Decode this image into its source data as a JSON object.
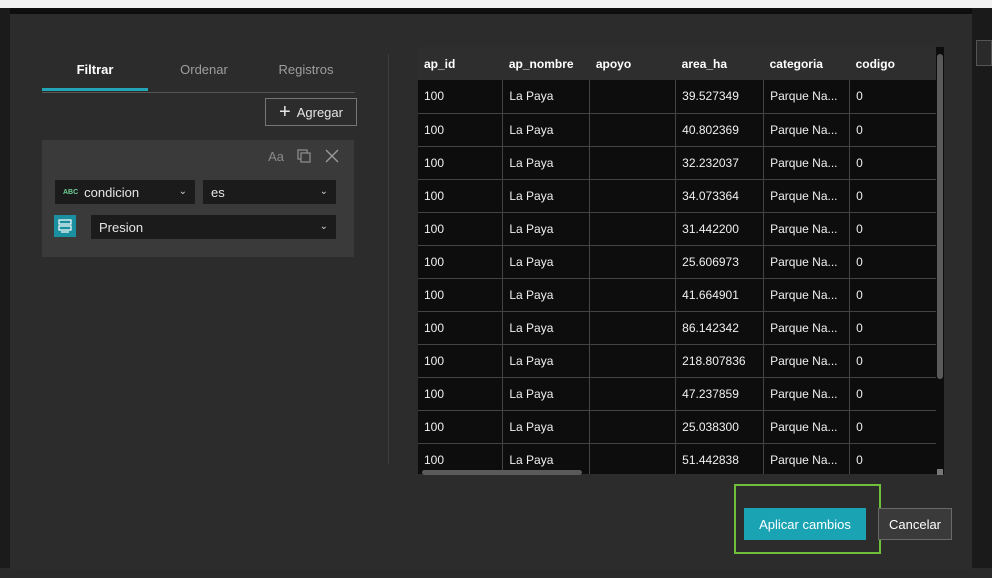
{
  "tabs": [
    {
      "label": "Filtrar"
    },
    {
      "label": "Ordenar"
    },
    {
      "label": "Registros"
    }
  ],
  "add_button": {
    "label": "Agregar"
  },
  "filter_card": {
    "tools": {
      "case_label": "Aa"
    },
    "field_select": {
      "type_label": "ABC",
      "value": "condicion"
    },
    "operator_select": {
      "value": "es"
    },
    "value_select": {
      "value": "Presion"
    }
  },
  "table": {
    "columns": [
      "ap_id",
      "ap_nombre",
      "apoyo",
      "area_ha",
      "categoria",
      "codigo"
    ],
    "rows": [
      [
        "100",
        "La Paya",
        "",
        "39.527349",
        "Parque Na...",
        "0"
      ],
      [
        "100",
        "La Paya",
        "",
        "40.802369",
        "Parque Na...",
        "0"
      ],
      [
        "100",
        "La Paya",
        "",
        "32.232037",
        "Parque Na...",
        "0"
      ],
      [
        "100",
        "La Paya",
        "",
        "34.073364",
        "Parque Na...",
        "0"
      ],
      [
        "100",
        "La Paya",
        "",
        "31.442200",
        "Parque Na...",
        "0"
      ],
      [
        "100",
        "La Paya",
        "",
        "25.606973",
        "Parque Na...",
        "0"
      ],
      [
        "100",
        "La Paya",
        "",
        "41.664901",
        "Parque Na...",
        "0"
      ],
      [
        "100",
        "La Paya",
        "",
        "86.142342",
        "Parque Na...",
        "0"
      ],
      [
        "100",
        "La Paya",
        "",
        "218.807836",
        "Parque Na...",
        "0"
      ],
      [
        "100",
        "La Paya",
        "",
        "47.237859",
        "Parque Na...",
        "0"
      ],
      [
        "100",
        "La Paya",
        "",
        "25.038300",
        "Parque Na...",
        "0"
      ],
      [
        "100",
        "La Paya",
        "",
        "51.442838",
        "Parque Na...",
        "0"
      ]
    ]
  },
  "footer": {
    "apply_label": "Aplicar cambios",
    "cancel_label": "Cancelar"
  },
  "colors": {
    "accent": "#1aa3b2",
    "highlight_border": "#6fbf3a",
    "dialog_bg": "#2c2c2c",
    "table_bg": "#0d0d0d"
  }
}
